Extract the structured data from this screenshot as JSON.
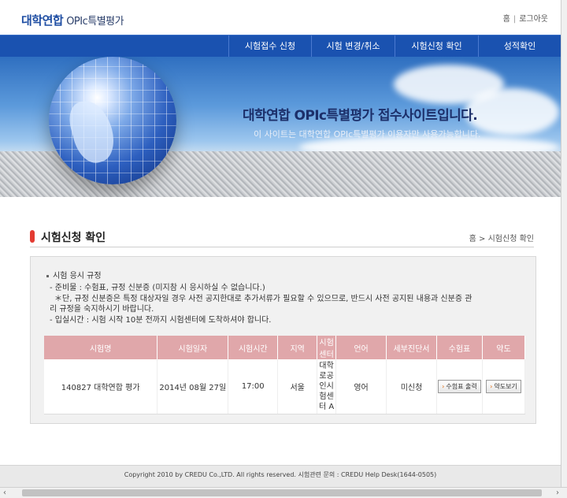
{
  "header": {
    "logo_main": "대학연합",
    "logo_sub": "OPIc특별평가",
    "util_home": "홈",
    "util_sep": "|",
    "util_logout": "로그아웃"
  },
  "nav": {
    "items": [
      "시험접수 신청",
      "시험 변경/취소",
      "시험신청 확인",
      "성적확인"
    ]
  },
  "banner": {
    "headline": "대학연합 OPIc특별평가 접수사이트입니다.",
    "subline": "이 사이트는 대학연합 OPIc특별평가 이용자만 사용가능합니다."
  },
  "page": {
    "title": "시험신청 확인",
    "breadcrumb": "홈 > 시험신청 확인"
  },
  "rules": {
    "heading": "시험 응시 규정",
    "line1": "- 준비물 : 수험표, 규정 신분증 (미지참 시 응시하실 수 없습니다.)",
    "line2": "＊단, 규정 신분증은 특정 대상자일 경우 사전 공지한대로 추가서류가 필요할 수 있으므로, 반드시 사전 공지된 내용과 신분증 관",
    "line3": "리 규정을 숙지하시기 바랍니다.",
    "line4": "- 입실시간 : 시험 시작 10분 전까지 시험센터에 도착하셔야 합니다."
  },
  "table": {
    "headers": [
      "시험명",
      "시험일자",
      "시험시간",
      "지역",
      "시험센터",
      "언어",
      "세부진단서",
      "수험표",
      "약도"
    ],
    "row": {
      "name": "140827 대학연합 평가",
      "date": "2014년 08월 27일",
      "time": "17:00",
      "region": "서울",
      "center": "대학로공인시험센터 A",
      "language": "영어",
      "diagnosis": "미신청",
      "ticket_button": "수험표 출력",
      "map_button": "약도보기"
    }
  },
  "footer": {
    "text": "Copyright 2010 by CREDU Co.,LTD. All rights reserved.   시험관련 문의 : CREDU Help Desk(1644-0505)"
  },
  "scroll": {
    "left_arrow": "‹",
    "right_arrow": "›"
  }
}
